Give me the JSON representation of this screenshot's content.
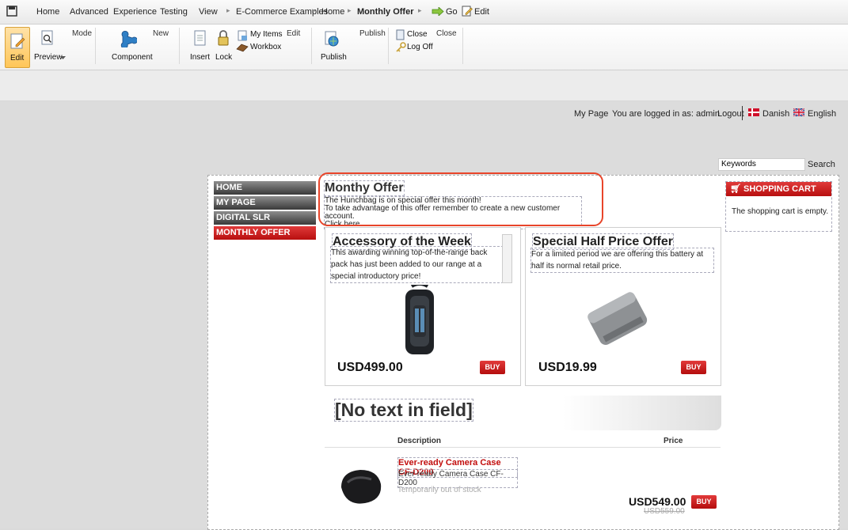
{
  "menubar": {
    "tabs": [
      "Home",
      "Advanced",
      "Experience",
      "Testing",
      "View"
    ],
    "breadcrumb": [
      "E-Commerce Examples",
      "Home",
      "Monthly Offer"
    ],
    "go_label": "Go",
    "edit_label": "Edit"
  },
  "ribbon": {
    "mode_label": "Mode",
    "edit_label": "Edit",
    "preview_label": "Preview",
    "new_label": "New",
    "component_label": "Component",
    "insert_label": "Insert",
    "lock_label": "Lock",
    "my_items_label": "My Items",
    "workbox_label": "Workbox",
    "edit_group_label": "Edit",
    "publish_group_label": "Publish",
    "publish_label": "Publish",
    "close_label": "Close",
    "close_group_label": "Close",
    "logoff_label": "Log Off"
  },
  "header": {
    "my_page": "My Page",
    "logged_in": "You are logged in as: admin",
    "logout": "Logout",
    "danish": "Danish",
    "english": "English",
    "keywords_value": "Keywords",
    "search_label": "Search"
  },
  "nav": [
    "HOME",
    "MY PAGE",
    "DIGITAL SLR",
    "MONTHLY OFFER"
  ],
  "offer": {
    "title": "Monthy Offer",
    "line1": "The Hunchbag is on special offer this month!",
    "line2": "To take advantage of this offer remember to create a new customer account.",
    "line3": "Click here."
  },
  "accessory": {
    "title": "Accessory of the Week",
    "desc": "This awarding winning top-of-the-range back pack has just been added to our range at a special introductory price!",
    "price": "USD499.00",
    "buy": "BUY"
  },
  "special": {
    "title": "Special Half Price Offer",
    "desc": "For a limited period we are offering this battery at half its normal retail price.",
    "price": "USD19.99",
    "buy": "BUY"
  },
  "cart": {
    "title": "SHOPPING CART",
    "empty": "The shopping cart is empty."
  },
  "listing": {
    "banner": "[No text in field]",
    "col_description": "Description",
    "col_price": "Price",
    "product_name": "Ever-ready Camera Case CF-D200",
    "product_desc": "Ever-ready Camera Case CF-D200",
    "stock": "Temporarily out of stock",
    "price": "USD549.00",
    "old_price": "USD559.00",
    "buy": "BUY"
  }
}
